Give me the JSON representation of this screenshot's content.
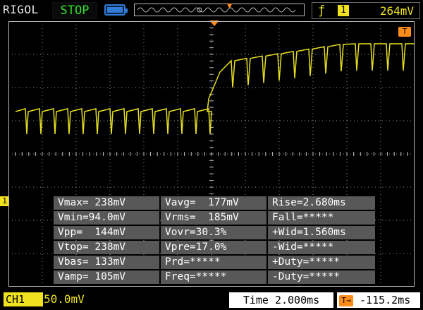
{
  "header": {
    "brand": "RIGOL",
    "run_state": "STOP",
    "trigger_channel": "1",
    "trigger_level": "264mV"
  },
  "markers": {
    "trigger_pos": "T",
    "channel": "1"
  },
  "measurements": [
    [
      "Vmax= 238mV",
      "Vavg=  177mV",
      "Rise=2.680ms"
    ],
    [
      "Vmin=94.0mV",
      "Vrms=  185mV",
      "Fall=*****"
    ],
    [
      "Vpp=  144mV",
      "Vovr=30.3%",
      "+Wid=1.560ms"
    ],
    [
      "Vtop= 238mV",
      "Vpre=17.0%",
      "-Wid=*****"
    ],
    [
      "Vbas= 133mV",
      "Prd=*****",
      "+Duty=*****"
    ],
    [
      "Vamp= 105mV",
      "Freq=*****",
      "-Duty=*****"
    ]
  ],
  "footer": {
    "channel_label": "CH1",
    "volts_per_div": "50.0mV",
    "timebase": "Time 2.000ms",
    "trigger_offset": "-115.2ms"
  },
  "colors": {
    "trace": "#e6df20",
    "grid": "#b9b9b9",
    "accent": "#ff8c1a",
    "panel": "#585858"
  },
  "icons": {
    "trigger": "rising-edge-icon",
    "battery": "battery-icon",
    "offset": "offset-icon"
  }
}
